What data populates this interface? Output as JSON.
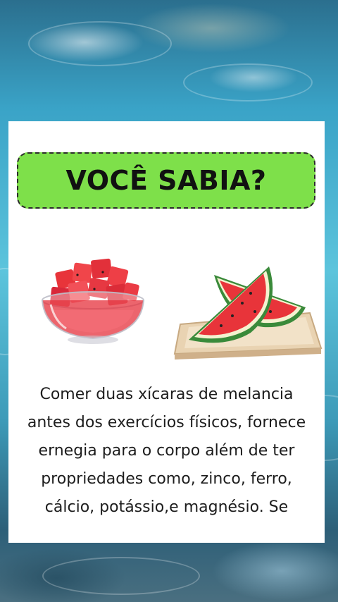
{
  "card": {
    "title": "VOCÊ SABIA?",
    "body_lines": [
      "Comer duas xícaras de melancia",
      "antes dos exercícios físicos, fornece",
      "ernegia para o corpo além de ter",
      "propriedades como, zinco, ferro,",
      "cálcio, potássio,e magnésio. Se"
    ],
    "images": [
      "watermelon-cubes-bowl",
      "watermelon-slices-tray"
    ]
  },
  "colors": {
    "title_background": "#7ee04a",
    "card_background": "#ffffff",
    "watermelon_flesh": "#e8343a",
    "watermelon_rind": "#3a8a3a"
  }
}
